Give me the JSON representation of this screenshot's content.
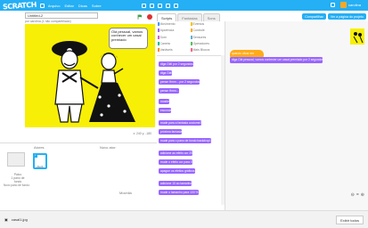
{
  "menubar": {
    "logo": "SCRATCH",
    "items": [
      "Arquivo",
      "Editar",
      "Dicas",
      "Sobre"
    ],
    "user": "carolina"
  },
  "project": {
    "title": "Untitled-2",
    "subtitle": "por carolina (1 não compartilhado)"
  },
  "stage": {
    "speech": "Olá pessoal, vamos conhecer um casal premiado",
    "coords": "x: 240 y: -180"
  },
  "sprites": {
    "header": "Atores",
    "new_sprite_label": "Novo ator:",
    "stage_label": "Palco",
    "stage_sublabel": "1 pano de fundo",
    "new_backdrop_label": "Novo pano de fundo:",
    "sprite_name": "Ator1",
    "sprite_badge": "i"
  },
  "tabs": [
    "Scripts",
    "Fantasias",
    "Sons"
  ],
  "categories": [
    {
      "label": "Movimento",
      "color": "#4c97ff"
    },
    {
      "label": "Eventos",
      "color": "#ffbf00"
    },
    {
      "label": "Aparência",
      "color": "#9966ff"
    },
    {
      "label": "Controle",
      "color": "#ffab19"
    },
    {
      "label": "Som",
      "color": "#cf63cf"
    },
    {
      "label": "Sensores",
      "color": "#5cb1d6"
    },
    {
      "label": "Caneta",
      "color": "#0fbd8c"
    },
    {
      "label": "Operadores",
      "color": "#59c059"
    },
    {
      "label": "Variáveis",
      "color": "#ff8c1a"
    },
    {
      "label": "Mais Blocos",
      "color": "#ff6680"
    }
  ],
  "blocks": [
    "diga Olá! por 2 segundos",
    "diga Olá!",
    "pense Hmm... por 2 segundos",
    "pense Hmm...",
    "mostre",
    "esconda",
    "mude para a fantasia costume2",
    "próxima fantasia",
    "mude para o pano de fundo backdrop1",
    "adicione ao efeito cor 25",
    "mude o efeito cor para 0",
    "apague os efeitos gráficos",
    "adicione 10 ao tamanho",
    "mude o tamanho para 100 %"
  ],
  "script": {
    "hat": "quando clicar em",
    "say": "diga Olá pessoal, vamos conhecer um casal premiado por 2 segundos"
  },
  "share": {
    "button1": "Compartilhar",
    "button2": "Ver a página do projeto"
  },
  "backpack": {
    "label": "Mochila",
    "download_name": "casal1.jpg",
    "show_all": "Exibir todos"
  }
}
